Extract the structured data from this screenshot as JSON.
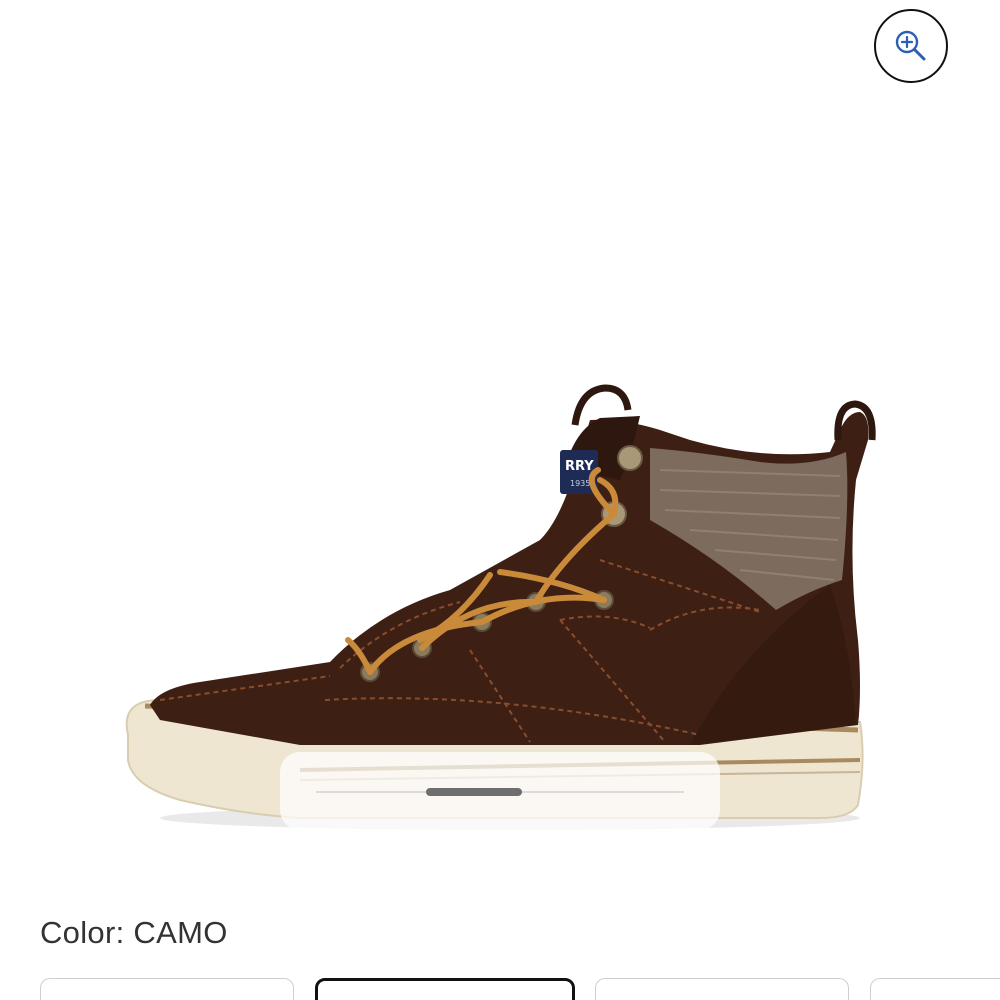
{
  "toolbar": {
    "zoom_icon": "zoom-in-icon"
  },
  "product": {
    "image_alt": "Brown suede high-top sneaker with tan laces",
    "logo_text": "RRY",
    "logo_subtext": "1935"
  },
  "carousel": {
    "active_index": 1,
    "progress": 0.33
  },
  "color": {
    "label": "Color: CAMO"
  },
  "swatches": [
    {
      "name": "swatch-1",
      "selected": false
    },
    {
      "name": "swatch-2",
      "selected": true
    },
    {
      "name": "swatch-3",
      "selected": false
    },
    {
      "name": "swatch-4",
      "selected": false
    }
  ],
  "colors": {
    "suede": "#3d1f14",
    "laces": "#c98a3a",
    "sole": "#efe6d2",
    "stripe": "#a88a5e",
    "collar": "#7d6b5d",
    "logo": "#1e2b55"
  }
}
